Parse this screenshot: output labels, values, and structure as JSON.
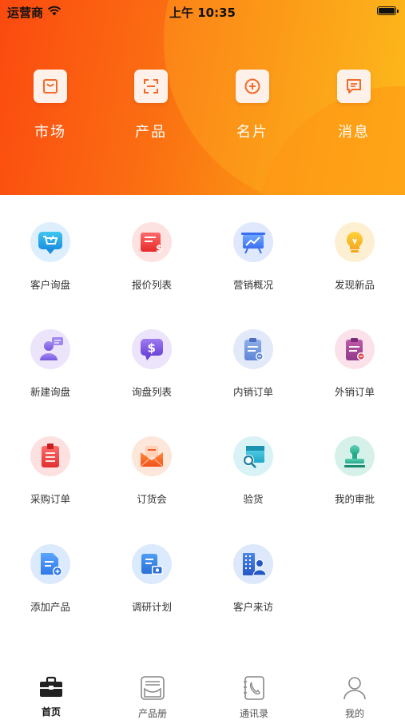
{
  "status_bar": {
    "carrier": "运营商",
    "time": "上午 10:35"
  },
  "quick_actions": [
    {
      "label": "市场",
      "icon": "shopping-bag-icon"
    },
    {
      "label": "产品",
      "icon": "scan-icon"
    },
    {
      "label": "名片",
      "icon": "plus-circle-icon"
    },
    {
      "label": "消息",
      "icon": "message-icon"
    }
  ],
  "grid": [
    {
      "label": "客户询盘",
      "icon": "cart-bubble-icon"
    },
    {
      "label": "报价列表",
      "icon": "price-list-icon"
    },
    {
      "label": "营销概况",
      "icon": "chart-board-icon"
    },
    {
      "label": "发现新品",
      "icon": "lightbulb-icon"
    },
    {
      "label": "新建询盘",
      "icon": "user-chat-icon"
    },
    {
      "label": "询盘列表",
      "icon": "dollar-chat-icon"
    },
    {
      "label": "内销订单",
      "icon": "clipboard-icon"
    },
    {
      "label": "外销订单",
      "icon": "clipboard-icon"
    },
    {
      "label": "采购订单",
      "icon": "purchase-list-icon"
    },
    {
      "label": "订货会",
      "icon": "envelope-icon"
    },
    {
      "label": "验货",
      "icon": "inspect-box-icon"
    },
    {
      "label": "我的审批",
      "icon": "stamp-icon"
    },
    {
      "label": "添加产品",
      "icon": "add-document-icon"
    },
    {
      "label": "调研计划",
      "icon": "research-plan-icon"
    },
    {
      "label": "客户来访",
      "icon": "visitor-building-icon"
    }
  ],
  "tabs": [
    {
      "label": "首页",
      "icon": "briefcase-icon",
      "active": true
    },
    {
      "label": "产品册",
      "icon": "catalog-icon",
      "active": false
    },
    {
      "label": "通讯录",
      "icon": "contacts-book-icon",
      "active": false
    },
    {
      "label": "我的",
      "icon": "person-icon",
      "active": false
    }
  ],
  "colors": {
    "accent": "#fb6f12",
    "header_start": "#fb4a10",
    "header_end": "#fcb817"
  }
}
